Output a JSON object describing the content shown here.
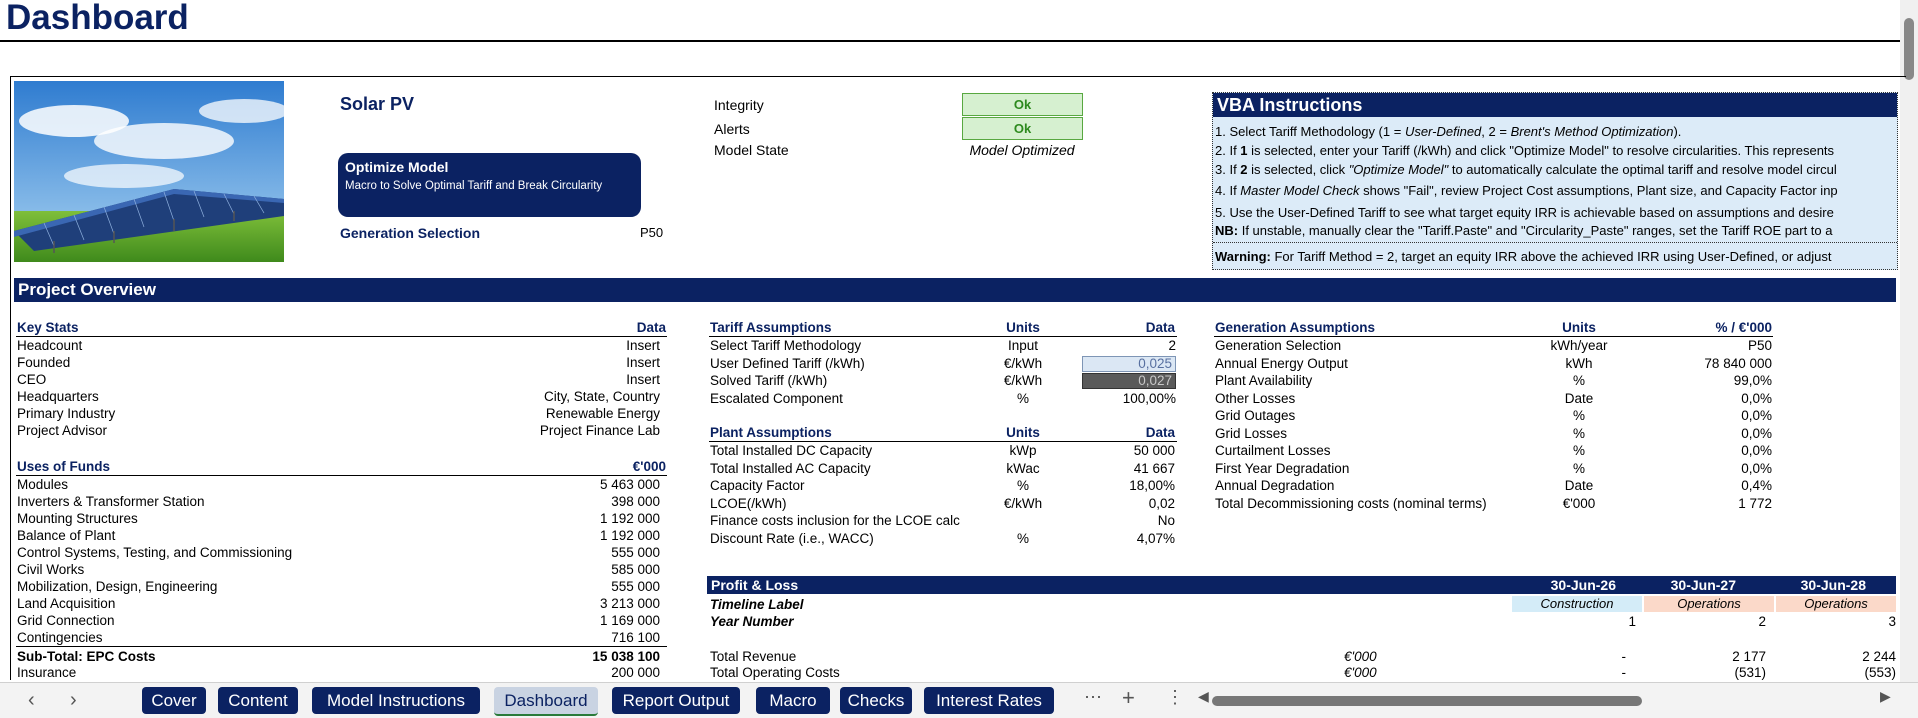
{
  "page_title": "Dashboard",
  "solar": {
    "title": "Solar PV",
    "optimize_title": "Optimize Model",
    "optimize_sub": "Macro to Solve Optimal Tariff and Break Circularity",
    "gen_sel_label": "Generation Selection",
    "gen_sel_value": "P50"
  },
  "status": {
    "integrity_label": "Integrity",
    "integrity_value": "Ok",
    "alerts_label": "Alerts",
    "alerts_value": "Ok",
    "state_label": "Model State",
    "state_value": "Model Optimized"
  },
  "vba": {
    "title": "VBA Instructions",
    "l1a": "1. Select Tariff Methodology (1 = ",
    "l1b": "User-Defined",
    "l1c": ", 2 = ",
    "l1d": "Brent's Method Optimization",
    "l1e": ").",
    "l2a": "2. If ",
    "l2b": "1",
    "l2c": " is selected, enter your Tariff (/kWh) and click \"Optimize Model\" to resolve circularities. This represents",
    "l3a": "3. If ",
    "l3b": "2",
    "l3c": " is selected, click ",
    "l3d": "\"Optimize Model\"",
    "l3e": " to automatically calculate the optimal tariff and resolve model circul",
    "l4a": "4. If ",
    "l4b": "Master Model Check",
    "l4c": " shows \"Fail\", review Project Cost assumptions, Plant size, and Capacity Factor inp",
    "l5": "5. Use the User-Defined Tariff to see what target equity IRR is achievable based on assumptions and desire",
    "nb_a": "NB:",
    "nb_b": " If unstable, manually clear the \"Tariff.Paste\" and \"Circularity_Paste\" ranges, set the Tariff ROE part to a",
    "warn_a": "Warning:",
    "warn_b": " For Tariff Method = 2, target an equity IRR above the achieved IRR using User-Defined, or adjust"
  },
  "project_overview": "Project Overview",
  "key_stats": {
    "header": "Key Stats",
    "data_header": "Data",
    "rows": [
      {
        "label": "Headcount",
        "value": "Insert"
      },
      {
        "label": "Founded",
        "value": "Insert"
      },
      {
        "label": "CEO",
        "value": "Insert"
      },
      {
        "label": "Headquarters",
        "value": "City, State, Country"
      },
      {
        "label": "Primary Industry",
        "value": "Renewable Energy"
      },
      {
        "label": "Project Advisor",
        "value": "Project Finance Lab"
      }
    ]
  },
  "uses": {
    "header": "Uses of Funds",
    "unit": "€'000",
    "rows": [
      {
        "label": "Modules",
        "value": "5 463 000"
      },
      {
        "label": "Inverters & Transformer Station",
        "value": "398 000"
      },
      {
        "label": "Mounting Structures",
        "value": "1 192 000"
      },
      {
        "label": "Balance of Plant",
        "value": "1 192 000"
      },
      {
        "label": "Control Systems, Testing, and Commissioning",
        "value": "555 000"
      },
      {
        "label": "Civil Works",
        "value": "585 000"
      },
      {
        "label": "Mobilization, Design, Engineering",
        "value": "555 000"
      },
      {
        "label": "Land Acquisition",
        "value": "3 213 000"
      },
      {
        "label": "Grid Connection",
        "value": "1 169 000"
      },
      {
        "label": "Contingencies",
        "value": "716 100"
      }
    ],
    "subtotal_label": "Sub-Total: EPC Costs",
    "subtotal_value": "15 038 100",
    "insurance_label": "Insurance",
    "insurance_value": "200 000"
  },
  "tariff": {
    "header": "Tariff Assumptions",
    "units_header": "Units",
    "data_header": "Data",
    "rows": [
      {
        "label": "Select Tariff Methodology",
        "unit": "Input",
        "value": "2"
      },
      {
        "label": "User Defined Tariff (/kWh)",
        "unit": "€/kWh",
        "value": "0,025"
      },
      {
        "label": "Solved Tariff (/kWh)",
        "unit": "€/kWh",
        "value": "0,027"
      },
      {
        "label": "Escalated Component",
        "unit": "%",
        "value": "100,00%"
      }
    ]
  },
  "plant": {
    "header": "Plant Assumptions",
    "units_header": "Units",
    "data_header": "Data",
    "rows": [
      {
        "label": "Total Installed DC Capacity",
        "unit": "kWp",
        "value": "50 000"
      },
      {
        "label": "Total Installed AC Capacity",
        "unit": "kWac",
        "value": "41 667"
      },
      {
        "label": "Capacity Factor",
        "unit": "%",
        "value": "18,00%"
      },
      {
        "label": "LCOE(/kWh)",
        "unit": "€/kWh",
        "value": "0,02"
      },
      {
        "label": "Finance costs inclusion for the LCOE calc",
        "unit": "",
        "value": "No"
      },
      {
        "label": "Discount Rate (i.e., WACC)",
        "unit": "%",
        "value": "4,07%"
      }
    ]
  },
  "generation": {
    "header": "Generation Assumptions",
    "units_header": "Units",
    "data_header": "% / €'000",
    "rows": [
      {
        "label": "Generation Selection",
        "unit": "kWh/year",
        "value": "P50"
      },
      {
        "label": "Annual Energy Output",
        "unit": "kWh",
        "value": "78 840 000"
      },
      {
        "label": "Plant Availability",
        "unit": "%",
        "value": "99,0%"
      },
      {
        "label": "Other Losses",
        "unit": "Date",
        "value": "0,0%"
      },
      {
        "label": "Grid Outages",
        "unit": "%",
        "value": "0,0%"
      },
      {
        "label": "Grid Losses",
        "unit": "%",
        "value": "0,0%"
      },
      {
        "label": "Curtailment Losses",
        "unit": "%",
        "value": "0,0%"
      },
      {
        "label": "First Year Degradation",
        "unit": "%",
        "value": "0,0%"
      },
      {
        "label": "Annual Degradation",
        "unit": "Date",
        "value": "0,4%"
      },
      {
        "label": "Total Decommissioning costs (nominal terms)",
        "unit": "€'000",
        "value": "1 772"
      }
    ]
  },
  "pl": {
    "header": "Profit & Loss",
    "dates": [
      "30-Jun-26",
      "30-Jun-27",
      "30-Jun-28"
    ],
    "timeline_label": "Timeline Label",
    "timeline": [
      "Construction",
      "Operations",
      "Operations"
    ],
    "year_label": "Year Number",
    "years": [
      "1",
      "2",
      "3"
    ],
    "revenue_label": "Total Revenue",
    "revenue_unit": "€'000",
    "revenue": [
      "-",
      "2 177",
      "2 244"
    ],
    "opex_label": "Total Operating Costs",
    "opex_unit": "€'000",
    "opex": [
      "-",
      "(531)",
      "(553)"
    ]
  },
  "tabs": [
    "Cover",
    "Content",
    "Model Instructions",
    "Dashboard",
    "Report Output",
    "Macro",
    "Checks",
    "Interest Rates"
  ],
  "active_tab": "Dashboard",
  "colors": {
    "navy": "#0b2262",
    "ok_green": "#d6f0d0",
    "construction": "#d4ecf8",
    "operations": "#fbd9c9"
  }
}
